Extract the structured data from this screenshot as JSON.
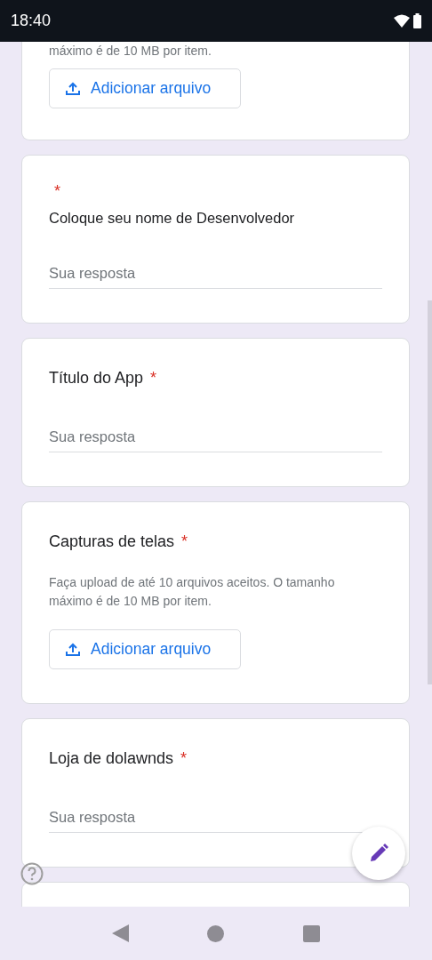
{
  "status_bar": {
    "time": "18:40"
  },
  "cards": [
    {
      "kind": "upload",
      "hint": "máximo é de 10 MB por item.",
      "button": "Adicionar arquivo"
    },
    {
      "kind": "text",
      "required_mark": "*",
      "description": "Coloque seu nome de Desenvolvedor",
      "placeholder": "Sua resposta"
    },
    {
      "kind": "text",
      "title": "Título do App",
      "required_mark": "*",
      "placeholder": "Sua resposta"
    },
    {
      "kind": "upload",
      "title": "Capturas de telas",
      "required_mark": "*",
      "hint": "Faça upload de até 10 arquivos aceitos. O tamanho máximo é de 10 MB por item.",
      "button": "Adicionar arquivo"
    },
    {
      "kind": "text",
      "title": "Loja de dolawnds",
      "required_mark": "*",
      "placeholder": "Sua resposta"
    },
    {
      "kind": "blank"
    }
  ]
}
